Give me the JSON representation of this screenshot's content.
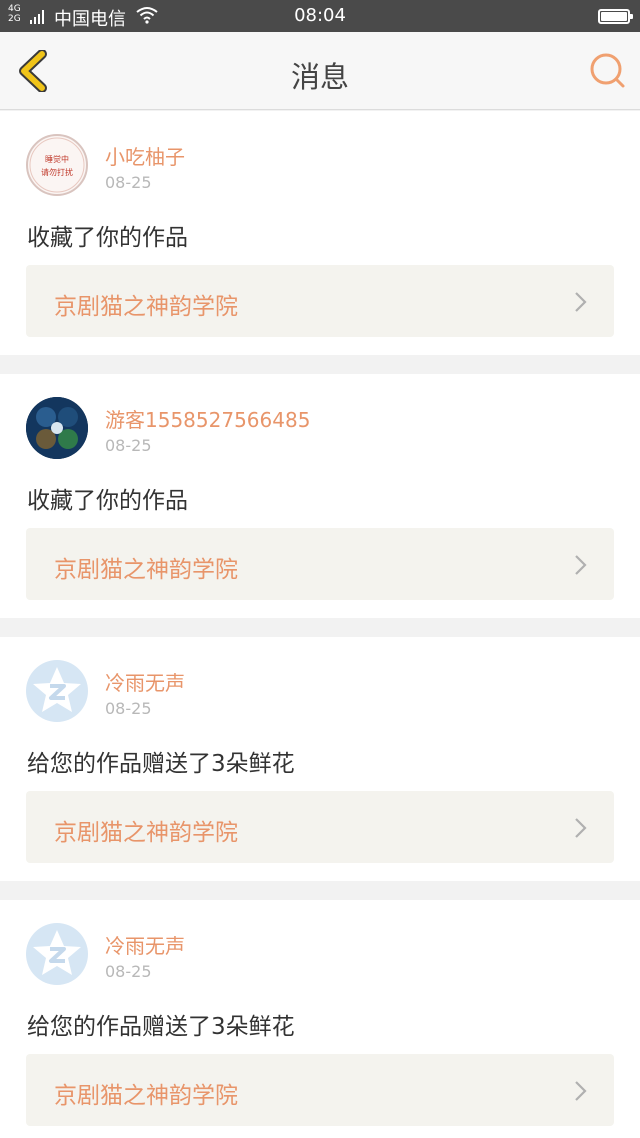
{
  "status": {
    "network_top": "4G",
    "network_bottom": "2G",
    "carrier": "中国电信",
    "time": "08:04"
  },
  "header": {
    "title": "消息"
  },
  "messages": [
    {
      "name": "小吃柚子",
      "date": "08-25",
      "text": "收藏了你的作品",
      "work": "京剧猫之神韵学院",
      "avatar": "stamp",
      "avatar_text": [
        "睡觉中",
        "请勿打扰"
      ]
    },
    {
      "name": "游客1558527566485",
      "date": "08-25",
      "text": "收藏了你的作品",
      "work": "京剧猫之神韵学院",
      "avatar": "game"
    },
    {
      "name": "冷雨无声",
      "date": "08-25",
      "text": "给您的作品赠送了3朵鲜花",
      "work": "京剧猫之神韵学院",
      "avatar": "qq"
    },
    {
      "name": "冷雨无声",
      "date": "08-25",
      "text": "给您的作品赠送了3朵鲜花",
      "work": "京剧猫之神韵学院",
      "avatar": "qq"
    }
  ],
  "colors": {
    "accent": "#e8956a",
    "back_arrow": "#f0c419",
    "back_arrow_outline": "#3a3a3a"
  }
}
